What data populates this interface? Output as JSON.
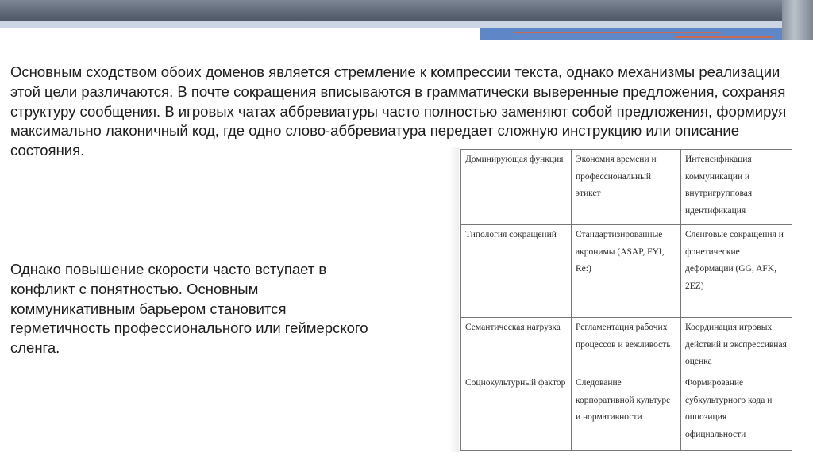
{
  "paragraphs": {
    "p1": "Основным сходством обоих доменов является стремление к компрессии текста, однако механизмы реализации этой цели различаются. В почте сокращения вписываются в грамматически выверенные предложения, сохраняя структуру сообщения. В игровых чатах аббревиатуры часто полностью заменяют собой предложения, формируя максимально лаконичный код, где одно слово-аббревиатура передает сложную инструкцию или описание состояния.",
    "p2": "Однако повышение скорости часто вступает в конфликт с понятностью. Основным коммуникативным барьером становится герметичность профессионального или геймерского сленга."
  },
  "table": {
    "rows": [
      [
        "Доминирующая функция",
        "Экономия времени и профессиональный этикет",
        "Интенсификация коммуникации и внутригрупповая идентификация"
      ],
      [
        "Типология сокращений",
        "Стандартизированные акронимы (ASAP, FYI, Re:)",
        "Сленговые сокращения и фонетические деформации (GG, AFK, 2EZ)"
      ],
      [
        "Семантическая нагрузка",
        "Регламентация рабочих процессов и вежливость",
        "Координация игровых действий и экспрессивная оценка"
      ],
      [
        "Социокультурный фактор",
        "Следование корпоративной культуре и нормативности",
        "Формирование субкультурного кода и оппозиция официальности"
      ]
    ]
  }
}
